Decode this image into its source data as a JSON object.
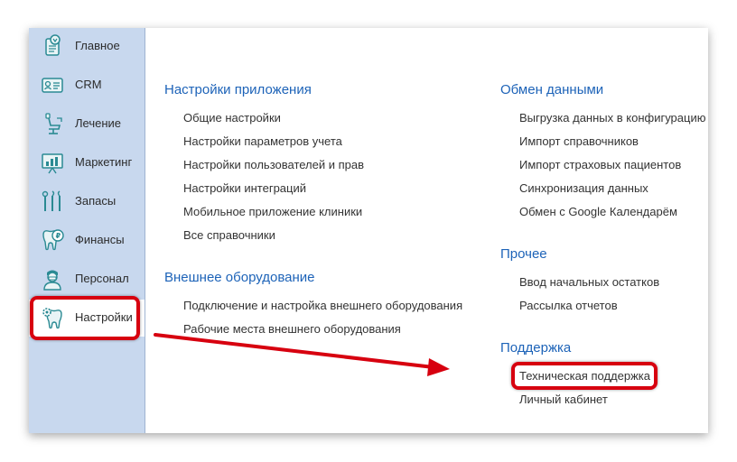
{
  "sidebar": {
    "items": [
      {
        "label": "Главное",
        "icon": "home-doc-icon"
      },
      {
        "label": "CRM",
        "icon": "contact-card-icon"
      },
      {
        "label": "Лечение",
        "icon": "dental-chair-icon"
      },
      {
        "label": "Маркетинг",
        "icon": "chart-board-icon"
      },
      {
        "label": "Запасы",
        "icon": "dental-tools-icon"
      },
      {
        "label": "Финансы",
        "icon": "tooth-coin-icon"
      },
      {
        "label": "Персонал",
        "icon": "doctor-icon"
      },
      {
        "label": "Настройки",
        "icon": "tooth-gear-icon",
        "active": true
      }
    ]
  },
  "sections": {
    "app_settings": {
      "title": "Настройки приложения",
      "links": [
        "Общие настройки",
        "Настройки параметров учета",
        "Настройки пользователей и прав",
        "Настройки интеграций",
        "Мобильное приложение клиники",
        "Все справочники"
      ]
    },
    "external_equipment": {
      "title": "Внешнее оборудование",
      "links": [
        "Подключение и настройка внешнего оборудования",
        "Рабочие места внешнего оборудования"
      ]
    },
    "data_exchange": {
      "title": "Обмен данными",
      "links": [
        "Выгрузка данных в конфигурацию",
        "Импорт справочников",
        "Импорт страховых пациентов",
        "Синхронизация данных",
        "Обмен с Google Календарём"
      ]
    },
    "other": {
      "title": "Прочее",
      "links": [
        "Ввод начальных остатков",
        "Рассылка отчетов"
      ]
    },
    "support": {
      "title": "Поддержка",
      "links": [
        "Техническая поддержка",
        "Личный кабинет"
      ]
    }
  },
  "colors": {
    "sidebar_bg": "#c8d8ee",
    "section_title": "#1d63b8",
    "highlight": "#d7000f",
    "icon_teal": "#2a8a93"
  }
}
